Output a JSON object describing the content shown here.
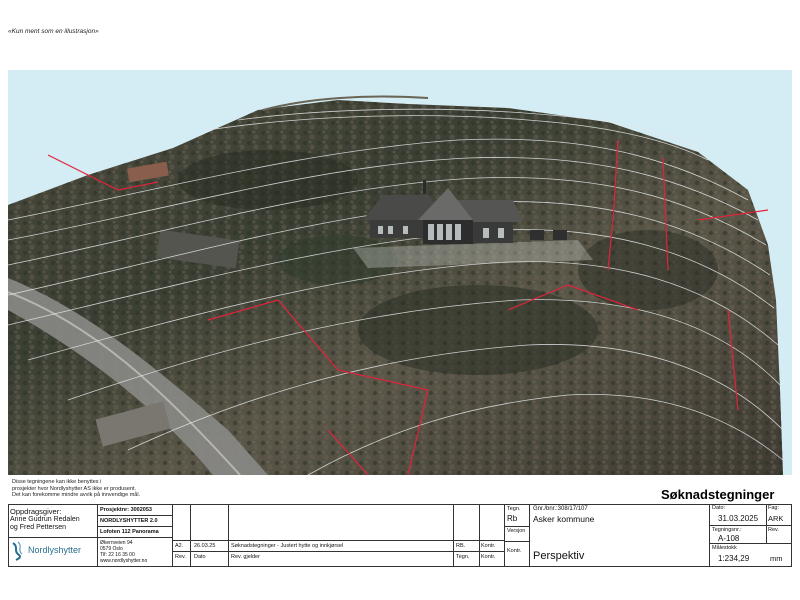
{
  "illustration_note": "«Kun ment som en illustrasjon»",
  "disclaimer": [
    "Disse tegningene kan ikke benyttes i",
    "prosjekter hvor Nordlyshytter AS ikke er produsent.",
    "Det kan forekomme mindre avvik på innvendige mål."
  ],
  "doc_title": "Søknadstegninger",
  "client": {
    "label": "Oppdragsgiver:",
    "names": [
      "Anne Gudrun Redalen",
      "og Fred Pettersen"
    ]
  },
  "project": {
    "number": "Prosjektnr: 3002053",
    "series": "NORDLYSHYTTER 2.0",
    "model": "Lofoten 112 Panorama"
  },
  "company": {
    "name": "Nordlyshytter",
    "address": [
      "Økernveien 94",
      "0579 Oslo",
      "Tlf: 22 16 35 00",
      "www.nordlyshytter.no"
    ]
  },
  "revision": {
    "row": [
      "A2.",
      "26.03.25",
      "Søknadstegninger - Justert hytte og innkjørsel",
      "RB.",
      "Kontr."
    ],
    "header": [
      "Rev.",
      "Dato",
      "Rev. gjelder",
      "Tegn.",
      "Kontr."
    ]
  },
  "fields": {
    "tegn_label": "Tegn.",
    "tegn_value": "Rb",
    "versjon_label": "Versjon",
    "kontr_label": "Kontr.",
    "gnr_label": "Gnr./bnr.:308/17/107",
    "municipality": "Asker kommune",
    "drawing_title": "Perspektiv",
    "dato_label": "Dato:",
    "dato_value": "31.03.2025",
    "fag_label": "Fag:",
    "fag_value": "ARK",
    "tegningsnr_label": "Tegningsnr.:",
    "tegningsnr_value": "A-108",
    "rev_label": "Rev.",
    "malestokk_label": "Målestokk",
    "malestokk_value": "1:234,29",
    "unit": "mm"
  }
}
